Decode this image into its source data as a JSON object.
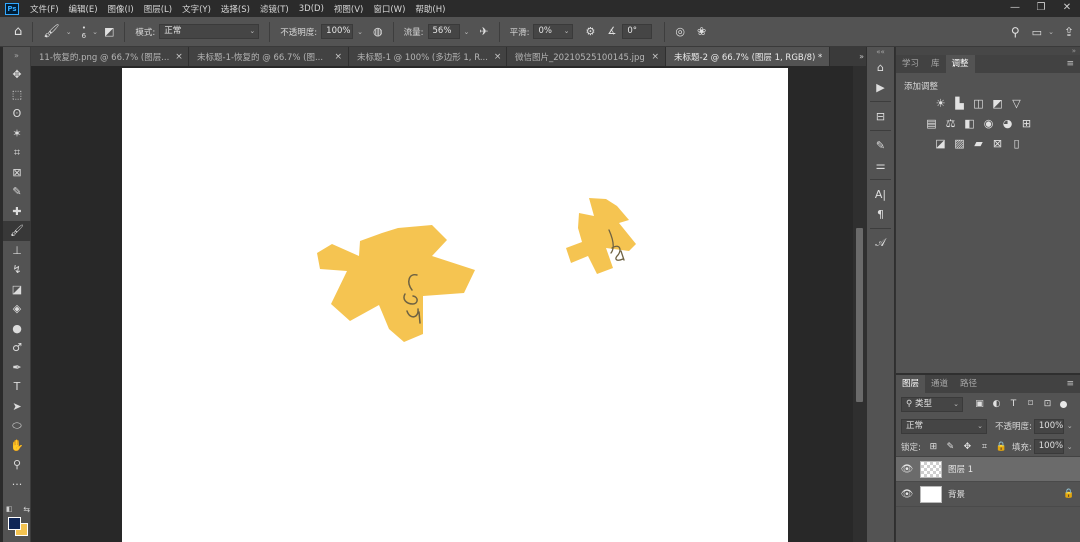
{
  "app": {
    "logo_text": "Ps",
    "menu": [
      "文件(F)",
      "编辑(E)",
      "图像(I)",
      "图层(L)",
      "文字(Y)",
      "选择(S)",
      "滤镜(T)",
      "3D(D)",
      "视图(V)",
      "窗口(W)",
      "帮助(H)"
    ],
    "window_controls": {
      "minimize": "—",
      "restore": "❐",
      "close": "✕"
    }
  },
  "options_bar": {
    "brush_size": "6",
    "mode_label": "模式:",
    "mode_value": "正常",
    "opacity_label": "不透明度:",
    "opacity_value": "100%",
    "flow_label": "流量:",
    "flow_value": "56%",
    "smoothing_label": "平滑:",
    "smoothing_value": "0%",
    "angle_value": "0°"
  },
  "tabs": [
    {
      "label": "11-恢复的.png @ 66.7% (图层...",
      "active": false
    },
    {
      "label": "未标题-1-恢复的 @ 66.7% (图...",
      "active": false
    },
    {
      "label": "未标题-1 @ 100% (多边形 1, R...",
      "active": false
    },
    {
      "label": "微信图片_20210525100145.jpg",
      "active": false
    },
    {
      "label": "未标题-2 @ 66.7% (图层 1, RGB/8) *",
      "active": true
    }
  ],
  "tab_close": "×",
  "tab_overflow": "»",
  "tools": [
    {
      "name": "move-tool",
      "icon": "✥"
    },
    {
      "name": "marquee-tool",
      "icon": "⬚"
    },
    {
      "name": "lasso-tool",
      "icon": "ʘ"
    },
    {
      "name": "magic-wand-tool",
      "icon": "✶"
    },
    {
      "name": "crop-tool",
      "icon": "⌗"
    },
    {
      "name": "frame-tool",
      "icon": "⊠"
    },
    {
      "name": "eyedropper-tool",
      "icon": "✎"
    },
    {
      "name": "healing-brush-tool",
      "icon": "✚"
    },
    {
      "name": "brush-tool",
      "icon": "🖌"
    },
    {
      "name": "clone-stamp-tool",
      "icon": "⊥"
    },
    {
      "name": "history-brush-tool",
      "icon": "↯"
    },
    {
      "name": "eraser-tool",
      "icon": "◪"
    },
    {
      "name": "paint-bucket-tool",
      "icon": "◈"
    },
    {
      "name": "blur-tool",
      "icon": "●"
    },
    {
      "name": "dodge-tool",
      "icon": "♂"
    },
    {
      "name": "pen-tool",
      "icon": "✒"
    },
    {
      "name": "type-tool",
      "icon": "T"
    },
    {
      "name": "path-selection-tool",
      "icon": "➤"
    },
    {
      "name": "shape-tool",
      "icon": "⬭"
    },
    {
      "name": "hand-tool",
      "icon": "✋"
    },
    {
      "name": "zoom-tool",
      "icon": "⚲"
    },
    {
      "name": "more-tools",
      "icon": "···"
    }
  ],
  "colors": {
    "foreground": "#0f2657",
    "background": "#f5c451",
    "flower": "#f5c451",
    "doodle": "#6e6242",
    "canvas": "#ffffff",
    "accent": "#31a8ff"
  },
  "adjust_panel": {
    "tabs": [
      "学习",
      "库",
      "调整"
    ],
    "active_tab": 2,
    "title": "添加调整",
    "row1": [
      "☀",
      "▙",
      "◫",
      "◩",
      "▽"
    ],
    "row2": [
      "▤",
      "⚖",
      "◧",
      "◉",
      "◕",
      "⊞"
    ],
    "row3": [
      "◪",
      "▨",
      "▰",
      "⊠",
      "▯"
    ]
  },
  "layers_panel": {
    "tabs": [
      "图层",
      "通道",
      "路径"
    ],
    "active_tab": 0,
    "filter_value": "类型",
    "blend_mode": "正常",
    "opacity_label": "不透明度:",
    "opacity_value": "100%",
    "lock_label": "锁定:",
    "fill_label": "填充:",
    "fill_value": "100%",
    "layers": [
      {
        "name": "图层 1",
        "selected": true,
        "thumb": "transparent",
        "locked": false
      },
      {
        "name": "背景",
        "selected": false,
        "thumb": "white",
        "locked": true
      }
    ]
  },
  "canvas_doodle": {
    "left_flower_text": "Lau",
    "right_flower_text": "ෂ"
  }
}
